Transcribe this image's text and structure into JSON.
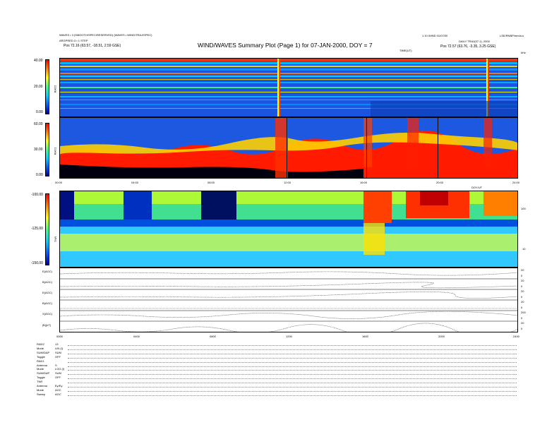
{
  "header": {
    "title": "WIND/WAVES Summary Plot (Page 1) for 07-JAN-2000, DOY = 7",
    "left_info_1": "WAVES • 3 (SMOOTH/SPEC/RESERVED) (WAVES • WIND/TRAJ/SPEC)",
    "left_info_2": "ARGPRED.3 • 1 STEP",
    "left_info_3": "Pos 72.16 (63.57, -18.51, 2.59 GSE)",
    "right_info_1": "1.10 WIND 01/07/00",
    "right_info_2": "DAILY TRAJ(07.1), 2000",
    "right_info_3": "Pos 72.57 (63.76, -3.35, 3.25 GSE)",
    "right_top": "LSE/RNBP/mm/a.s",
    "top_axis_label": "TIME(UT)",
    "top_axis_units": "kHz"
  },
  "chart_data": [
    {
      "type": "heatmap",
      "panel": "RAD2",
      "ylabel": "RAD2",
      "colorbar_ticks": [
        "40.00",
        "20.00",
        "0.00"
      ],
      "colorscale": [
        "#0000a0",
        "#0060ff",
        "#00d0ff",
        "#40ff80",
        "#ffff00",
        "#ff8000",
        "#ff0000"
      ]
    },
    {
      "type": "heatmap",
      "panel": "RAD1",
      "ylabel": "RAD1",
      "colorbar_ticks": [
        "60.00",
        "30.00",
        "0.00"
      ],
      "time_ticks": [
        "00:00",
        "04:00",
        "08:00",
        "12:00",
        "16:00",
        "20:00",
        "24:00"
      ],
      "x_annotation": "DOY/UT"
    },
    {
      "type": "heatmap",
      "panel": "TNR",
      "ylabel": "TNR",
      "colorbar_ticks": [
        "-100.00",
        "-125.00",
        "-150.00"
      ],
      "right_ticks": [
        "100",
        "10"
      ]
    },
    {
      "type": "line",
      "panel": "Spin plane components",
      "series": [
        {
          "name": "E(AGC)",
          "right_ticks": [
            "20",
            "0"
          ]
        },
        {
          "name": "B(AGC)",
          "right_ticks": [
            "20",
            "0"
          ]
        },
        {
          "name": "E(AGC)",
          "right_ticks": [
            "20",
            "0"
          ]
        },
        {
          "name": "B(AGC)",
          "right_ticks": [
            "20",
            "0"
          ]
        },
        {
          "name": "X(AGC)",
          "right_ticks": [
            "200",
            "0"
          ]
        },
        {
          "name": "|B|(nT)",
          "right_ticks": [
            "20",
            "0"
          ]
        }
      ],
      "time_ticks": [
        "0000",
        "0400",
        "0800",
        "1200",
        "1600",
        "2000",
        "2400"
      ]
    }
  ],
  "info_table": {
    "rows": [
      {
        "label": "RAD2",
        "value": "13"
      },
      {
        "label": "Mode",
        "value": "LIN (I)"
      },
      {
        "label": "SUM/DAP",
        "value": "SUM"
      },
      {
        "label": "Toggle",
        "value": "OFF"
      },
      {
        "label": "RAD1",
        "value": ""
      },
      {
        "label": "Antenna",
        "value": "S"
      },
      {
        "label": "Mode",
        "value": "LOG (I)"
      },
      {
        "label": "SUM/DAP",
        "value": "SUM"
      },
      {
        "label": "Toggle",
        "value": "OFF"
      },
      {
        "label": "TNR",
        "value": ""
      },
      {
        "label": "Antenna",
        "value": "Ey/Ey"
      },
      {
        "label": "Mode",
        "value": "AGC"
      },
      {
        "label": "Sweep",
        "value": "AGC"
      }
    ]
  }
}
